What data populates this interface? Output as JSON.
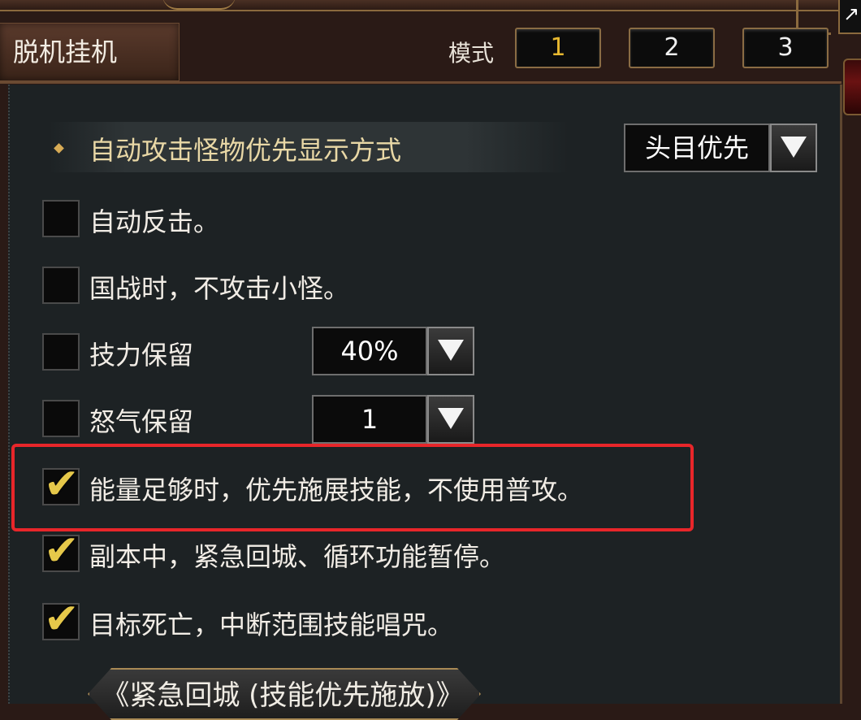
{
  "header": {
    "tab_label": "脱机挂机",
    "mode_label": "模式",
    "modes": [
      "1",
      "2",
      "3"
    ],
    "active_mode": "1"
  },
  "window": {
    "close_glyph": "↗"
  },
  "section": {
    "title": "自动攻击怪物优先显示方式",
    "dropdown_value": "头目优先"
  },
  "options": [
    {
      "label": "自动反击。",
      "checked": false
    },
    {
      "label": "国战时，不攻击小怪。",
      "checked": false
    },
    {
      "label": "技力保留",
      "checked": false,
      "select_value": "40%"
    },
    {
      "label": "怒气保留",
      "checked": false,
      "select_value": "1"
    },
    {
      "label": "能量足够时，优先施展技能，不使用普攻。",
      "checked": true,
      "highlighted": true
    },
    {
      "label": "副本中，紧急回城、循环功能暂停。",
      "checked": true
    },
    {
      "label": "目标死亡，中断范围技能唱咒。",
      "checked": true
    }
  ],
  "footer": {
    "banner_text": "《紧急回城 (技能优先施放)》"
  },
  "colors": {
    "highlight_border": "#e8262a",
    "check_mark": "#e6c84a",
    "active_mode": "#e8b930",
    "section_title": "#e9d8a6"
  },
  "icons": {
    "dropdown": "triangle-down-icon",
    "check": "check-icon",
    "bullet": "diamond-bullet-icon"
  }
}
